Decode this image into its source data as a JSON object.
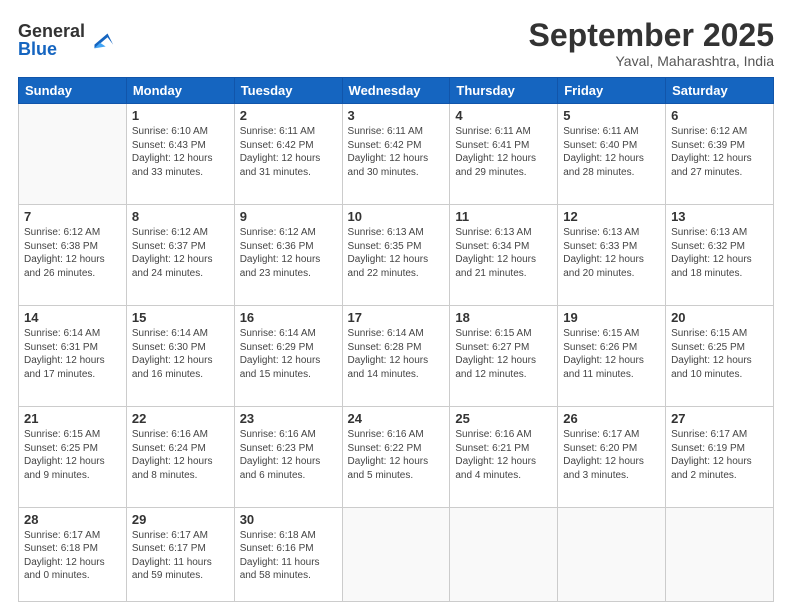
{
  "logo": {
    "general": "General",
    "blue": "Blue"
  },
  "title": "September 2025",
  "location": "Yaval, Maharashtra, India",
  "days": [
    "Sunday",
    "Monday",
    "Tuesday",
    "Wednesday",
    "Thursday",
    "Friday",
    "Saturday"
  ],
  "weeks": [
    [
      {
        "day": "",
        "info": ""
      },
      {
        "day": "1",
        "info": "Sunrise: 6:10 AM\nSunset: 6:43 PM\nDaylight: 12 hours\nand 33 minutes."
      },
      {
        "day": "2",
        "info": "Sunrise: 6:11 AM\nSunset: 6:42 PM\nDaylight: 12 hours\nand 31 minutes."
      },
      {
        "day": "3",
        "info": "Sunrise: 6:11 AM\nSunset: 6:42 PM\nDaylight: 12 hours\nand 30 minutes."
      },
      {
        "day": "4",
        "info": "Sunrise: 6:11 AM\nSunset: 6:41 PM\nDaylight: 12 hours\nand 29 minutes."
      },
      {
        "day": "5",
        "info": "Sunrise: 6:11 AM\nSunset: 6:40 PM\nDaylight: 12 hours\nand 28 minutes."
      },
      {
        "day": "6",
        "info": "Sunrise: 6:12 AM\nSunset: 6:39 PM\nDaylight: 12 hours\nand 27 minutes."
      }
    ],
    [
      {
        "day": "7",
        "info": "Sunrise: 6:12 AM\nSunset: 6:38 PM\nDaylight: 12 hours\nand 26 minutes."
      },
      {
        "day": "8",
        "info": "Sunrise: 6:12 AM\nSunset: 6:37 PM\nDaylight: 12 hours\nand 24 minutes."
      },
      {
        "day": "9",
        "info": "Sunrise: 6:12 AM\nSunset: 6:36 PM\nDaylight: 12 hours\nand 23 minutes."
      },
      {
        "day": "10",
        "info": "Sunrise: 6:13 AM\nSunset: 6:35 PM\nDaylight: 12 hours\nand 22 minutes."
      },
      {
        "day": "11",
        "info": "Sunrise: 6:13 AM\nSunset: 6:34 PM\nDaylight: 12 hours\nand 21 minutes."
      },
      {
        "day": "12",
        "info": "Sunrise: 6:13 AM\nSunset: 6:33 PM\nDaylight: 12 hours\nand 20 minutes."
      },
      {
        "day": "13",
        "info": "Sunrise: 6:13 AM\nSunset: 6:32 PM\nDaylight: 12 hours\nand 18 minutes."
      }
    ],
    [
      {
        "day": "14",
        "info": "Sunrise: 6:14 AM\nSunset: 6:31 PM\nDaylight: 12 hours\nand 17 minutes."
      },
      {
        "day": "15",
        "info": "Sunrise: 6:14 AM\nSunset: 6:30 PM\nDaylight: 12 hours\nand 16 minutes."
      },
      {
        "day": "16",
        "info": "Sunrise: 6:14 AM\nSunset: 6:29 PM\nDaylight: 12 hours\nand 15 minutes."
      },
      {
        "day": "17",
        "info": "Sunrise: 6:14 AM\nSunset: 6:28 PM\nDaylight: 12 hours\nand 14 minutes."
      },
      {
        "day": "18",
        "info": "Sunrise: 6:15 AM\nSunset: 6:27 PM\nDaylight: 12 hours\nand 12 minutes."
      },
      {
        "day": "19",
        "info": "Sunrise: 6:15 AM\nSunset: 6:26 PM\nDaylight: 12 hours\nand 11 minutes."
      },
      {
        "day": "20",
        "info": "Sunrise: 6:15 AM\nSunset: 6:25 PM\nDaylight: 12 hours\nand 10 minutes."
      }
    ],
    [
      {
        "day": "21",
        "info": "Sunrise: 6:15 AM\nSunset: 6:25 PM\nDaylight: 12 hours\nand 9 minutes."
      },
      {
        "day": "22",
        "info": "Sunrise: 6:16 AM\nSunset: 6:24 PM\nDaylight: 12 hours\nand 8 minutes."
      },
      {
        "day": "23",
        "info": "Sunrise: 6:16 AM\nSunset: 6:23 PM\nDaylight: 12 hours\nand 6 minutes."
      },
      {
        "day": "24",
        "info": "Sunrise: 6:16 AM\nSunset: 6:22 PM\nDaylight: 12 hours\nand 5 minutes."
      },
      {
        "day": "25",
        "info": "Sunrise: 6:16 AM\nSunset: 6:21 PM\nDaylight: 12 hours\nand 4 minutes."
      },
      {
        "day": "26",
        "info": "Sunrise: 6:17 AM\nSunset: 6:20 PM\nDaylight: 12 hours\nand 3 minutes."
      },
      {
        "day": "27",
        "info": "Sunrise: 6:17 AM\nSunset: 6:19 PM\nDaylight: 12 hours\nand 2 minutes."
      }
    ],
    [
      {
        "day": "28",
        "info": "Sunrise: 6:17 AM\nSunset: 6:18 PM\nDaylight: 12 hours\nand 0 minutes."
      },
      {
        "day": "29",
        "info": "Sunrise: 6:17 AM\nSunset: 6:17 PM\nDaylight: 11 hours\nand 59 minutes."
      },
      {
        "day": "30",
        "info": "Sunrise: 6:18 AM\nSunset: 6:16 PM\nDaylight: 11 hours\nand 58 minutes."
      },
      {
        "day": "",
        "info": ""
      },
      {
        "day": "",
        "info": ""
      },
      {
        "day": "",
        "info": ""
      },
      {
        "day": "",
        "info": ""
      }
    ]
  ]
}
